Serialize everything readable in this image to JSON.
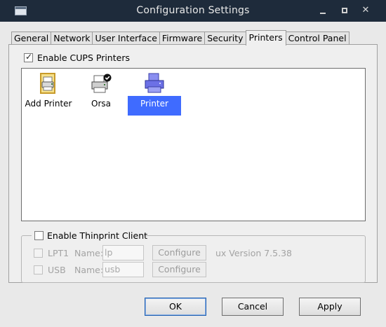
{
  "window": {
    "title": "Configuration Settings"
  },
  "tabs": [
    "General",
    "Network",
    "User Interface",
    "Firmware",
    "Security",
    "Printers",
    "Control Panel"
  ],
  "active_tab": "Printers",
  "cups": {
    "label": "Enable CUPS Printers",
    "checked": true
  },
  "printers": [
    {
      "label": "Add Printer",
      "icon": "add-printer-icon"
    },
    {
      "label": "Orsa",
      "icon": "default-printer-icon"
    },
    {
      "label": "Printer",
      "icon": "printer-icon",
      "selected": true
    }
  ],
  "thinprint": {
    "label": "Enable Thinprint Client",
    "checked": false,
    "rows": [
      {
        "port": "LPT1",
        "name_label": "Name:",
        "name_value": "lp",
        "configure": "Configure"
      },
      {
        "port": "USB",
        "name_label": "Name:",
        "name_value": "usb",
        "configure": "Configure"
      }
    ],
    "version": "ux Version 7.5.38"
  },
  "buttons": {
    "ok": "OK",
    "cancel": "Cancel",
    "apply": "Apply"
  },
  "colors": {
    "titlebar": "#1e2b3b",
    "selection": "#3f6bff"
  }
}
